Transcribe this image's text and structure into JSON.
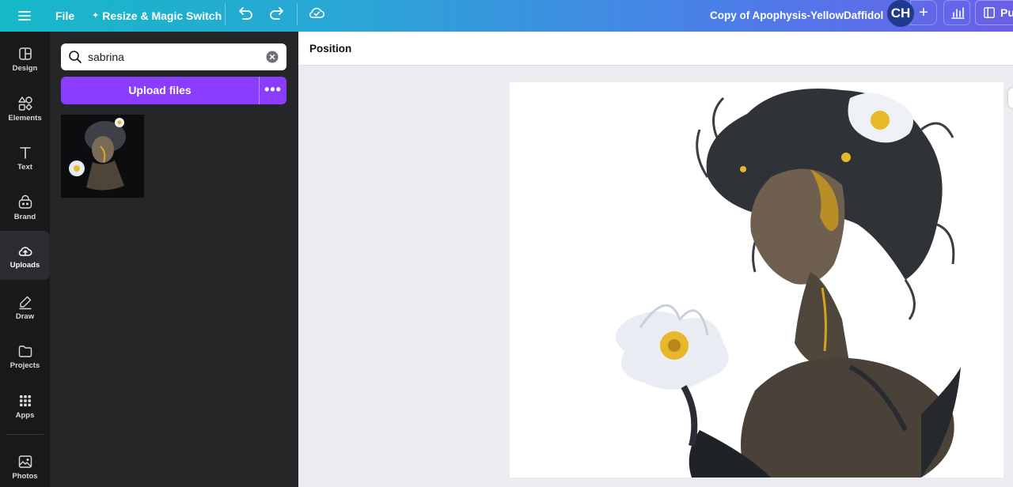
{
  "topbar": {
    "menu_icon": "hamburger-menu-icon",
    "file_label": "File",
    "resize_label": "Resize & Magic Switch",
    "undo_icon": "undo-icon",
    "redo_icon": "redo-icon",
    "cloud_icon": "cloud-saved-icon",
    "document_title": "Copy of Apophysis-YellowDaffidol",
    "avatar_initials": "CH",
    "add_label": "+",
    "stats_icon": "bar-chart-icon",
    "publish_label": "Pu"
  },
  "rail": {
    "items": [
      {
        "label": "Design",
        "icon": "design-icon"
      },
      {
        "label": "Elements",
        "icon": "elements-icon"
      },
      {
        "label": "Text",
        "icon": "text-icon"
      },
      {
        "label": "Brand",
        "icon": "brand-icon"
      },
      {
        "label": "Uploads",
        "icon": "uploads-icon",
        "active": true
      },
      {
        "label": "Draw",
        "icon": "draw-icon"
      },
      {
        "label": "Projects",
        "icon": "projects-icon"
      },
      {
        "label": "Apps",
        "icon": "apps-icon"
      },
      {
        "label": "Photos",
        "icon": "photos-icon"
      }
    ]
  },
  "panel": {
    "search_value": "sabrina",
    "upload_label": "Upload files",
    "more_label": "•••"
  },
  "editor": {
    "position_label": "Position"
  },
  "colors": {
    "accent": "#8b3dff",
    "rail_bg": "#18191b",
    "panel_bg": "#252627",
    "canvas_bg": "#ebecf0"
  }
}
